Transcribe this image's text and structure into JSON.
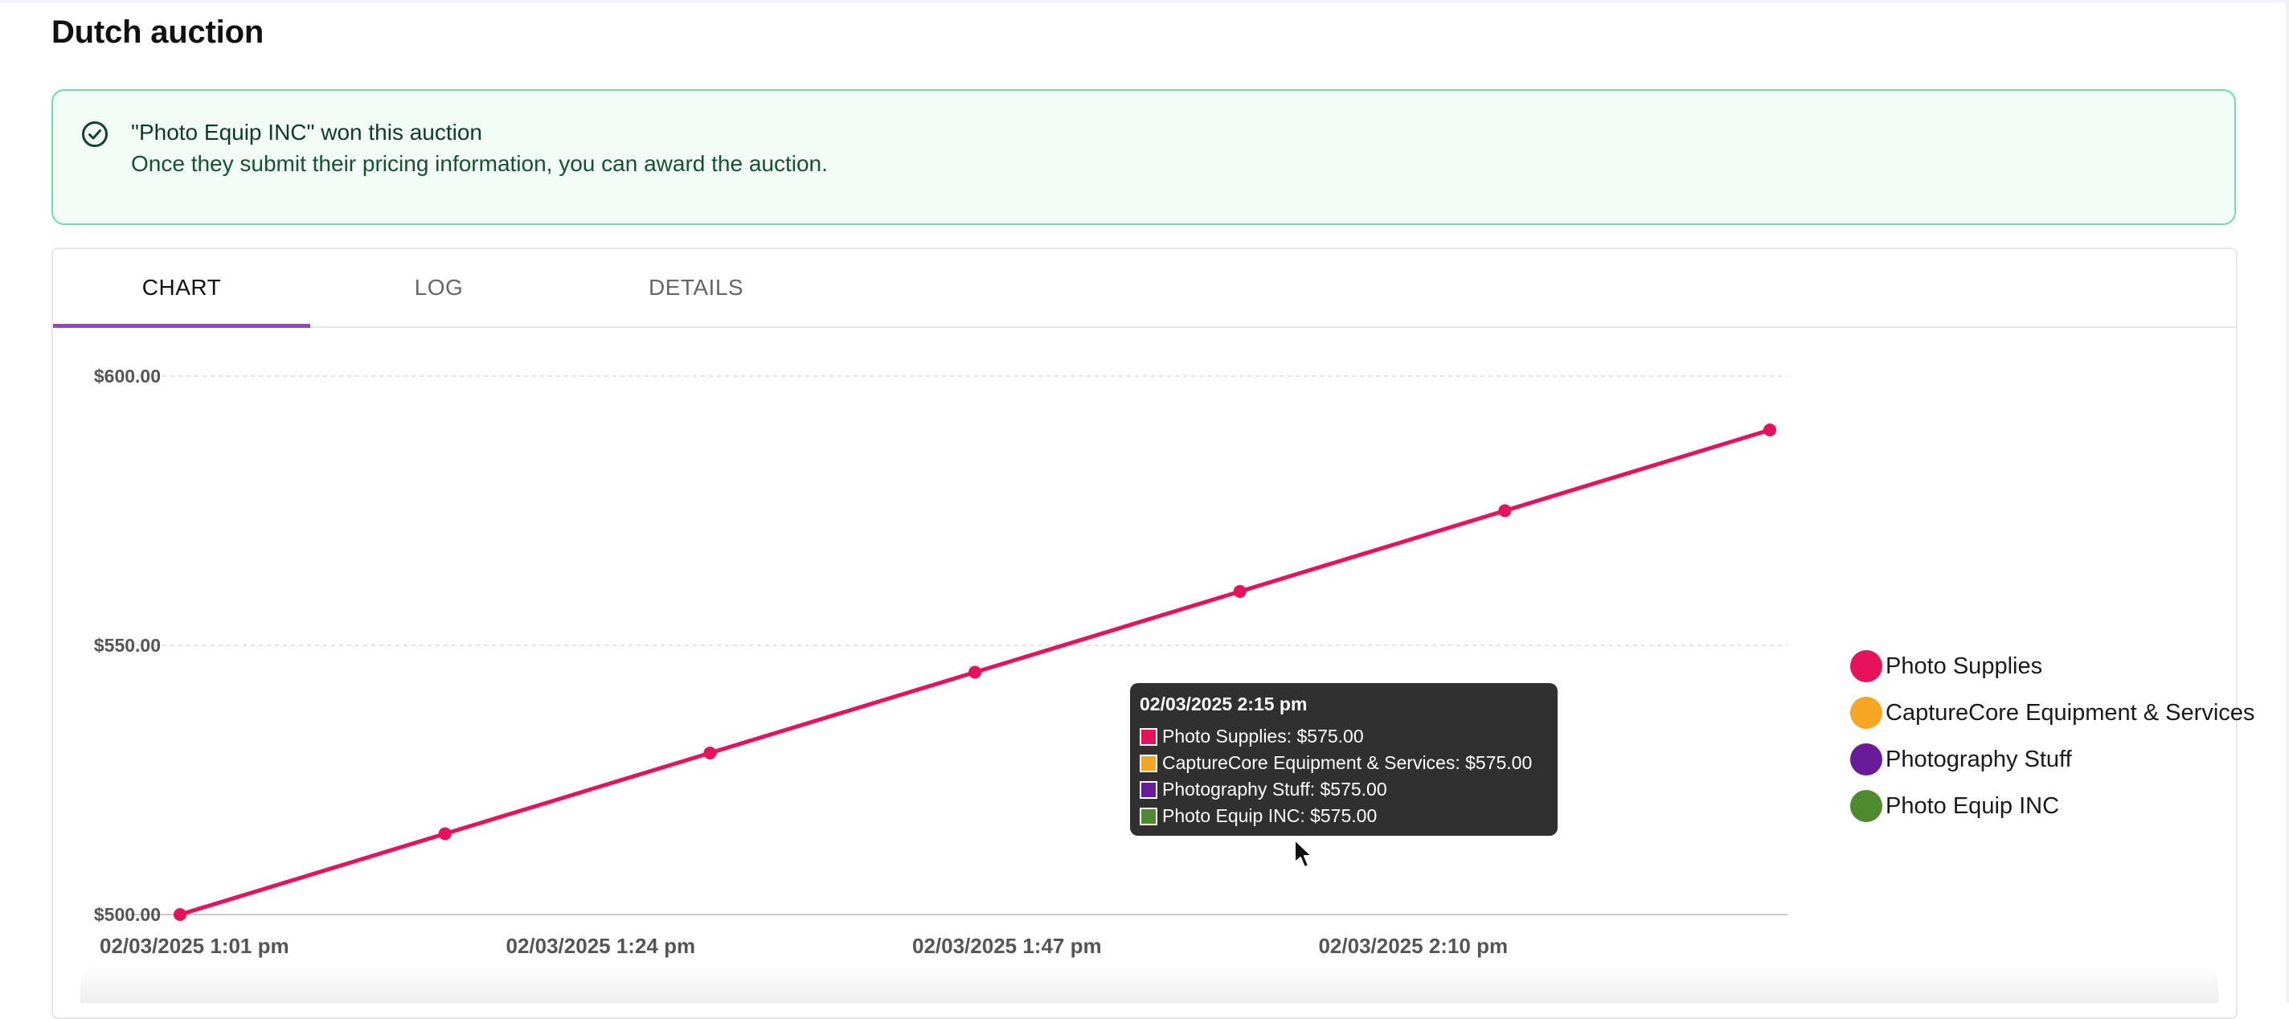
{
  "page": {
    "title": "Dutch auction"
  },
  "alert": {
    "title": "\"Photo Equip INC\" won this auction",
    "description": "Once they submit their pricing information, you can award the auction.",
    "icon": "check-circle-icon",
    "colors": {
      "background": "#f2fdf7",
      "border": "#6ee0a6",
      "text": "#0f3b24"
    }
  },
  "tabs": [
    {
      "label": "CHART",
      "active": true
    },
    {
      "label": "LOG",
      "active": false
    },
    {
      "label": "DETAILS",
      "active": false
    }
  ],
  "accent_color": "#9b3fd6",
  "chart_data": {
    "type": "line",
    "x_label_ticks": [
      "02/03/2025 1:01 pm",
      "02/03/2025 1:24 pm",
      "02/03/2025 1:47 pm",
      "02/03/2025 2:10 pm"
    ],
    "y_ticks": [
      {
        "value": 500,
        "label": "$500.00"
      },
      {
        "value": 550,
        "label": "$550.00"
      },
      {
        "value": 600,
        "label": "$600.00"
      }
    ],
    "ylim": [
      500,
      600
    ],
    "xlim": [
      "02/03/2025 1:01 pm",
      "02/03/2025 2:32 pm"
    ],
    "grid": true,
    "legend_position": "right",
    "series": [
      {
        "name": "Photo Supplies",
        "color": "#e8115b",
        "points": [
          {
            "x": "02/03/2025 1:01 pm",
            "y": 500
          },
          {
            "x": "02/03/2025 1:16 pm",
            "y": 515
          },
          {
            "x": "02/03/2025 1:31 pm",
            "y": 530
          },
          {
            "x": "02/03/2025 1:46 pm",
            "y": 545
          },
          {
            "x": "02/03/2025 2:01 pm",
            "y": 560
          },
          {
            "x": "02/03/2025 2:16 pm",
            "y": 575
          },
          {
            "x": "02/03/2025 2:31 pm",
            "y": 590
          }
        ]
      },
      {
        "name": "CaptureCore Equipment & Services",
        "color": "#f5a623",
        "points": []
      },
      {
        "name": "Photography Stuff",
        "color": "#6a1b9a",
        "points": []
      },
      {
        "name": "Photo Equip INC",
        "color": "#4e8a2e",
        "points": []
      }
    ],
    "tooltip": {
      "title": "02/03/2025 2:15 pm",
      "rows": [
        {
          "label": "Photo Supplies: $575.00",
          "color": "#e8115b"
        },
        {
          "label": "CaptureCore Equipment & Services: $575.00",
          "color": "#f5a623"
        },
        {
          "label": "Photography Stuff: $575.00",
          "color": "#6a1b9a"
        },
        {
          "label": "Photo Equip INC: $575.00",
          "color": "#4e8a2e"
        }
      ]
    }
  }
}
